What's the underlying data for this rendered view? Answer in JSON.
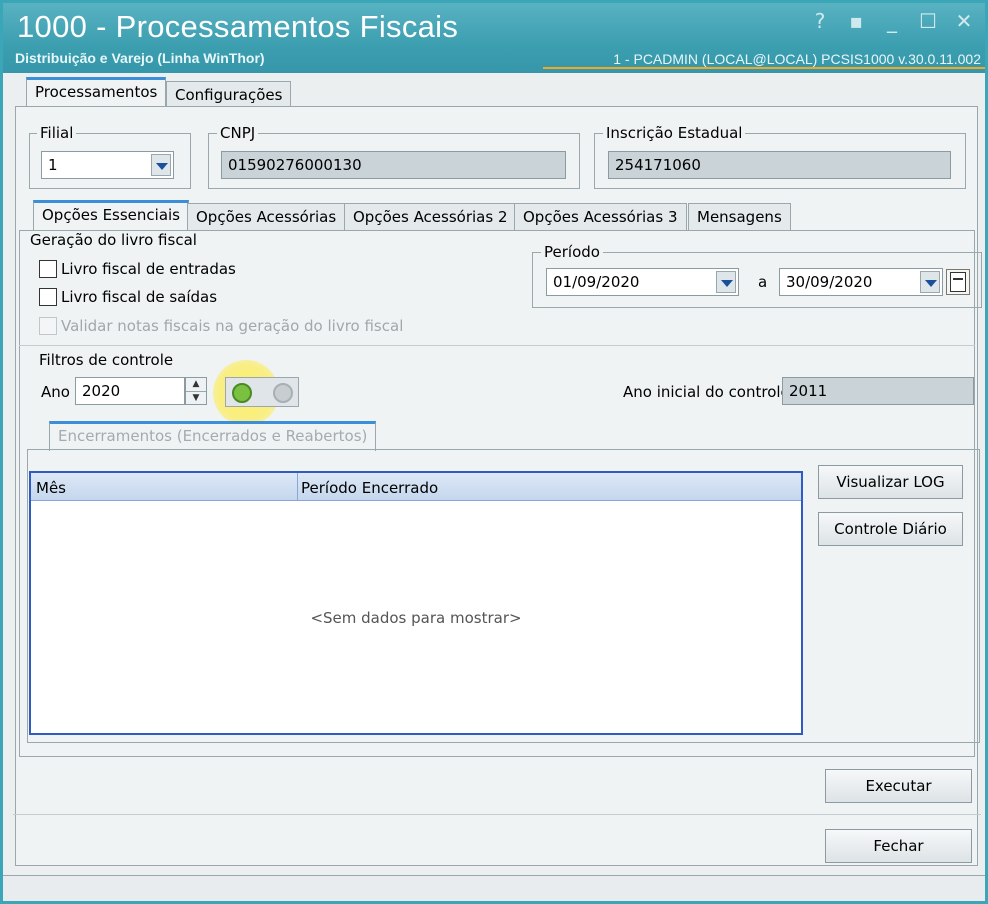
{
  "window": {
    "title": "1000 - Processamentos Fiscais",
    "subtitle": "Distribuição e Varejo (Linha WinThor)",
    "user_info": "1 - PCADMIN (LOCAL@LOCAL)   PCSIS1000  v.30.0.11.002",
    "controls": [
      "?",
      "▪",
      "_",
      "☐",
      "✕"
    ]
  },
  "main_tabs": [
    {
      "label": "Processamentos",
      "active": true
    },
    {
      "label": "Configurações",
      "active": false
    }
  ],
  "filial": {
    "label": "Filial",
    "value": "1"
  },
  "cnpj": {
    "label": "CNPJ",
    "value": "01590276000130"
  },
  "inscricao": {
    "label": "Inscrição Estadual",
    "value": "254171060"
  },
  "sub_tabs": [
    {
      "label": "Opções Essenciais",
      "active": true
    },
    {
      "label": "Opções Acessórias",
      "active": false
    },
    {
      "label": "Opções Acessórias 2",
      "active": false
    },
    {
      "label": "Opções Acessórias 3",
      "active": false
    },
    {
      "label": "Mensagens",
      "active": false
    }
  ],
  "livro": {
    "label": "Geração do livro fiscal",
    "entradas": "Livro fiscal de entradas",
    "saidas": "Livro fiscal de saídas",
    "validar": "Validar notas fiscais na geração do livro fiscal"
  },
  "periodo": {
    "label": "Período",
    "start": "01/09/2020",
    "separator": "a",
    "end": "30/09/2020"
  },
  "filtros": {
    "label": "Filtros de controle",
    "ano_label": "Ano",
    "ano_value": "2020",
    "ano_inicial_label": "Ano inicial do controle",
    "ano_inicial_value": "2011"
  },
  "encerramentos": {
    "tab_label": "Encerramentos (Encerrados e Reabertos)",
    "columns": [
      "Mês",
      "Período Encerrado"
    ],
    "empty": "<Sem dados para mostrar>"
  },
  "buttons": {
    "visualizar_log": "Visualizar LOG",
    "controle_diario": "Controle Diário",
    "executar": "Executar",
    "fechar": "Fechar"
  }
}
